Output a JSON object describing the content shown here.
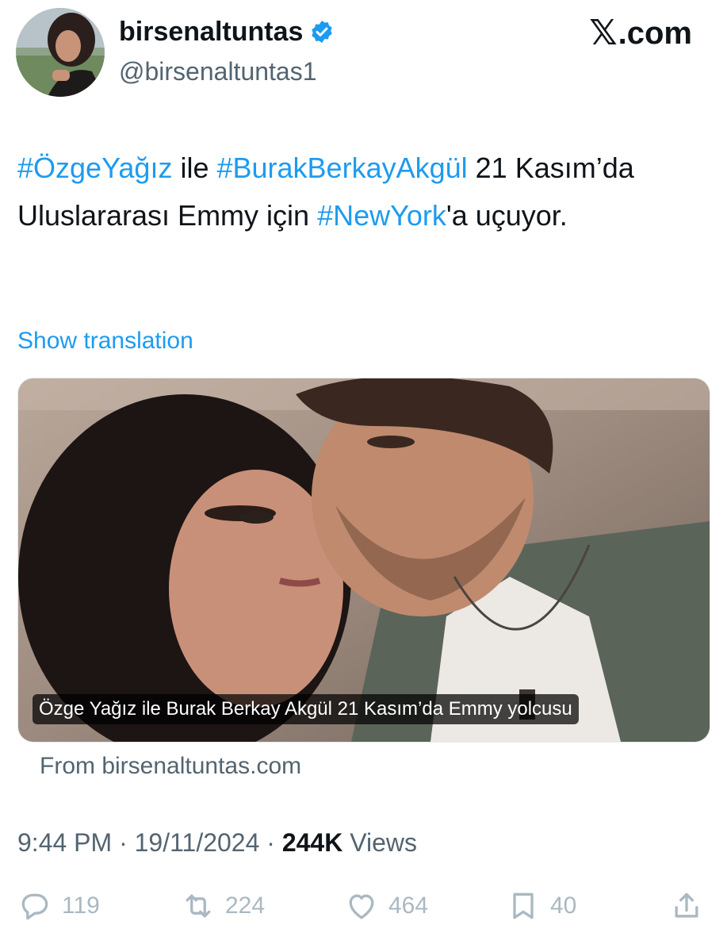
{
  "header": {
    "display_name": "birsenaltuntas",
    "handle": "@birsenaltuntas1",
    "site_logo": ".com",
    "verified_color": "#1d9bf0"
  },
  "tweet": {
    "parts": [
      {
        "text": "#ÖzgeYağız",
        "hashtag": true
      },
      {
        "text": " ile ",
        "hashtag": false
      },
      {
        "text": "#BurakBerkayAkgül",
        "hashtag": true
      },
      {
        "text": " 21 Kasım’da Uluslararası Emmy için ",
        "hashtag": false
      },
      {
        "text": "#NewYork",
        "hashtag": true
      },
      {
        "text": "'a uçuyor.",
        "hashtag": false
      }
    ],
    "show_translation": "Show translation"
  },
  "card": {
    "caption": "Özge Yağız ile Burak Berkay Akgül 21 Kasım’da Emmy yolcusu",
    "source": "From birsenaltuntas.com"
  },
  "meta": {
    "time": "9:44 PM",
    "separator": "·",
    "date": "19/11/2024",
    "views_count": "244K",
    "views_label": "Views"
  },
  "actions": {
    "replies": "119",
    "reposts": "224",
    "likes": "464",
    "bookmarks": "40"
  },
  "colors": {
    "link": "#1d9bf0",
    "secondary_text": "#536471",
    "action_icons": "#aab8c2"
  },
  "icons": [
    "verified-badge-icon",
    "x-logo-icon",
    "reply-icon",
    "repost-icon",
    "like-icon",
    "bookmark-icon",
    "share-icon"
  ]
}
